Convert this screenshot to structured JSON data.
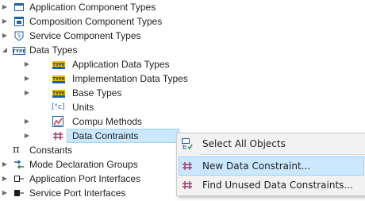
{
  "tree": {
    "items": [
      {
        "label": "Application Component Types"
      },
      {
        "label": "Composition Component Types"
      },
      {
        "label": "Service Component Types"
      },
      {
        "label": "Data Types"
      },
      {
        "label": "Application Data Types"
      },
      {
        "label": "Implementation Data Types"
      },
      {
        "label": "Base Types"
      },
      {
        "label": "Units",
        "icon_text": "[°c]"
      },
      {
        "label": "Compu Methods"
      },
      {
        "label": "Data Contraints"
      },
      {
        "label": "Constants",
        "icon_text": "π"
      },
      {
        "label": "Mode Declaration Groups"
      },
      {
        "label": "Application Port Interfaces"
      },
      {
        "label": "Service Port Interfaces"
      }
    ],
    "type_badge": "TYPE"
  },
  "context_menu": {
    "items": [
      {
        "label": "Select All Objects"
      },
      {
        "label": "New Data Constraint..."
      },
      {
        "label": "Find Unused Data Constraints..."
      }
    ]
  },
  "colors": {
    "selection": "#cce8ff",
    "selection_border": "#99d1ff",
    "menu_bg": "#f2f2f2",
    "icon_blue": "#1f5fa8",
    "constraint_purple": "#7a3fa0"
  }
}
